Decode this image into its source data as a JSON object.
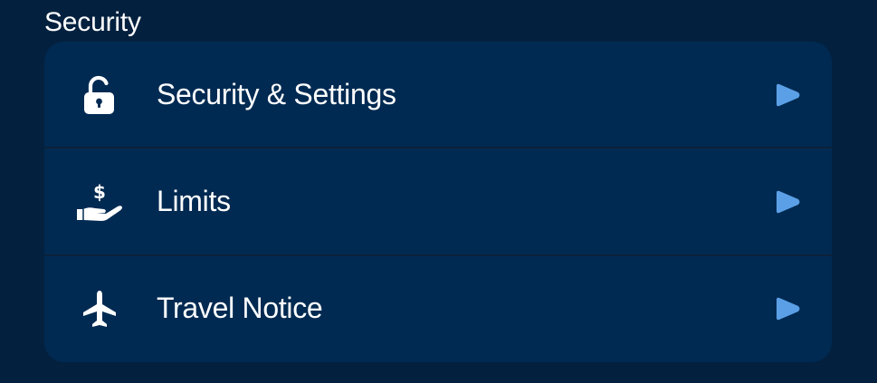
{
  "section": {
    "title": "Security"
  },
  "colors": {
    "background": "#03213f",
    "card": "#002a52",
    "text": "#ffffff",
    "accent": "#5ba0e6"
  },
  "rows": [
    {
      "label": "Security & Settings",
      "icon": "lock-icon",
      "chevron": "play-arrow-icon"
    },
    {
      "label": "Limits",
      "icon": "hand-dollar-icon",
      "chevron": "play-arrow-icon"
    },
    {
      "label": "Travel Notice",
      "icon": "airplane-icon",
      "chevron": "play-arrow-icon"
    }
  ]
}
